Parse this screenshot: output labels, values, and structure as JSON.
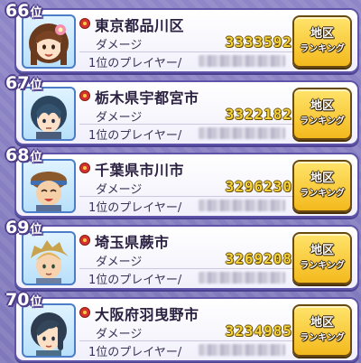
{
  "rows": [
    {
      "rank": "66",
      "rank_suffix": "位",
      "prefecture": "東京都品川区",
      "damage_label": "ダメージ",
      "damage": "3333592",
      "player_label": "1位のプレイヤー/",
      "button_line1": "地区",
      "button_line2": "ランキング",
      "avatar": "girl-brown-hair-flower"
    },
    {
      "rank": "67",
      "rank_suffix": "位",
      "prefecture": "栃木県宇都宮市",
      "damage_label": "ダメージ",
      "damage": "3322182",
      "player_label": "1位のプレイヤー/",
      "button_line1": "地区",
      "button_line2": "ランキング",
      "avatar": "boy-dark-blue-hair"
    },
    {
      "rank": "68",
      "rank_suffix": "位",
      "prefecture": "千葉県市川市",
      "damage_label": "ダメージ",
      "damage": "3296230",
      "player_label": "1位のプレイヤー/",
      "button_line1": "地区",
      "button_line2": "ランキング",
      "avatar": "boy-headband-smiling"
    },
    {
      "rank": "69",
      "rank_suffix": "位",
      "prefecture": "埼玉県蕨市",
      "damage_label": "ダメージ",
      "damage": "3269208",
      "player_label": "1位のプレイヤー/",
      "button_line1": "地区",
      "button_line2": "ランキング",
      "avatar": "boy-blonde-hair"
    },
    {
      "rank": "70",
      "rank_suffix": "位",
      "prefecture": "大阪府羽曳野市",
      "damage_label": "ダメージ",
      "damage": "3234985",
      "player_label": "1位のプレイヤー/",
      "button_line1": "地区",
      "button_line2": "ランキング",
      "avatar": "girl-dark-ponytail"
    }
  ],
  "colors": {
    "background": "#8e86c7",
    "card_border": "#5e55a8",
    "damage_value": "#f3d23a",
    "button": "#f3b91d",
    "medal": "#d4322c"
  }
}
